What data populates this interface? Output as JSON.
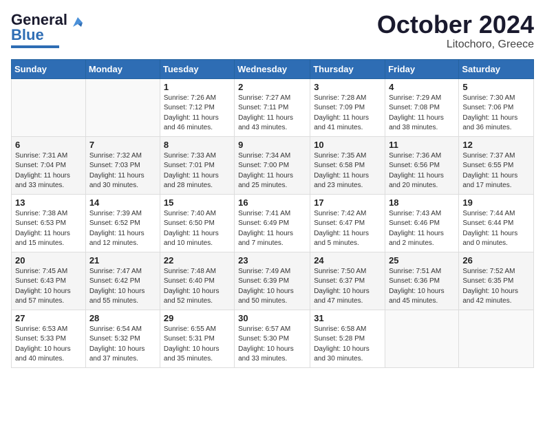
{
  "header": {
    "logo_line1": "General",
    "logo_line2": "Blue",
    "month": "October 2024",
    "location": "Litochoro, Greece"
  },
  "weekdays": [
    "Sunday",
    "Monday",
    "Tuesday",
    "Wednesday",
    "Thursday",
    "Friday",
    "Saturday"
  ],
  "weeks": [
    [
      {
        "day": "",
        "info": ""
      },
      {
        "day": "",
        "info": ""
      },
      {
        "day": "1",
        "info": "Sunrise: 7:26 AM\nSunset: 7:12 PM\nDaylight: 11 hours and 46 minutes."
      },
      {
        "day": "2",
        "info": "Sunrise: 7:27 AM\nSunset: 7:11 PM\nDaylight: 11 hours and 43 minutes."
      },
      {
        "day": "3",
        "info": "Sunrise: 7:28 AM\nSunset: 7:09 PM\nDaylight: 11 hours and 41 minutes."
      },
      {
        "day": "4",
        "info": "Sunrise: 7:29 AM\nSunset: 7:08 PM\nDaylight: 11 hours and 38 minutes."
      },
      {
        "day": "5",
        "info": "Sunrise: 7:30 AM\nSunset: 7:06 PM\nDaylight: 11 hours and 36 minutes."
      }
    ],
    [
      {
        "day": "6",
        "info": "Sunrise: 7:31 AM\nSunset: 7:04 PM\nDaylight: 11 hours and 33 minutes."
      },
      {
        "day": "7",
        "info": "Sunrise: 7:32 AM\nSunset: 7:03 PM\nDaylight: 11 hours and 30 minutes."
      },
      {
        "day": "8",
        "info": "Sunrise: 7:33 AM\nSunset: 7:01 PM\nDaylight: 11 hours and 28 minutes."
      },
      {
        "day": "9",
        "info": "Sunrise: 7:34 AM\nSunset: 7:00 PM\nDaylight: 11 hours and 25 minutes."
      },
      {
        "day": "10",
        "info": "Sunrise: 7:35 AM\nSunset: 6:58 PM\nDaylight: 11 hours and 23 minutes."
      },
      {
        "day": "11",
        "info": "Sunrise: 7:36 AM\nSunset: 6:56 PM\nDaylight: 11 hours and 20 minutes."
      },
      {
        "day": "12",
        "info": "Sunrise: 7:37 AM\nSunset: 6:55 PM\nDaylight: 11 hours and 17 minutes."
      }
    ],
    [
      {
        "day": "13",
        "info": "Sunrise: 7:38 AM\nSunset: 6:53 PM\nDaylight: 11 hours and 15 minutes."
      },
      {
        "day": "14",
        "info": "Sunrise: 7:39 AM\nSunset: 6:52 PM\nDaylight: 11 hours and 12 minutes."
      },
      {
        "day": "15",
        "info": "Sunrise: 7:40 AM\nSunset: 6:50 PM\nDaylight: 11 hours and 10 minutes."
      },
      {
        "day": "16",
        "info": "Sunrise: 7:41 AM\nSunset: 6:49 PM\nDaylight: 11 hours and 7 minutes."
      },
      {
        "day": "17",
        "info": "Sunrise: 7:42 AM\nSunset: 6:47 PM\nDaylight: 11 hours and 5 minutes."
      },
      {
        "day": "18",
        "info": "Sunrise: 7:43 AM\nSunset: 6:46 PM\nDaylight: 11 hours and 2 minutes."
      },
      {
        "day": "19",
        "info": "Sunrise: 7:44 AM\nSunset: 6:44 PM\nDaylight: 11 hours and 0 minutes."
      }
    ],
    [
      {
        "day": "20",
        "info": "Sunrise: 7:45 AM\nSunset: 6:43 PM\nDaylight: 10 hours and 57 minutes."
      },
      {
        "day": "21",
        "info": "Sunrise: 7:47 AM\nSunset: 6:42 PM\nDaylight: 10 hours and 55 minutes."
      },
      {
        "day": "22",
        "info": "Sunrise: 7:48 AM\nSunset: 6:40 PM\nDaylight: 10 hours and 52 minutes."
      },
      {
        "day": "23",
        "info": "Sunrise: 7:49 AM\nSunset: 6:39 PM\nDaylight: 10 hours and 50 minutes."
      },
      {
        "day": "24",
        "info": "Sunrise: 7:50 AM\nSunset: 6:37 PM\nDaylight: 10 hours and 47 minutes."
      },
      {
        "day": "25",
        "info": "Sunrise: 7:51 AM\nSunset: 6:36 PM\nDaylight: 10 hours and 45 minutes."
      },
      {
        "day": "26",
        "info": "Sunrise: 7:52 AM\nSunset: 6:35 PM\nDaylight: 10 hours and 42 minutes."
      }
    ],
    [
      {
        "day": "27",
        "info": "Sunrise: 6:53 AM\nSunset: 5:33 PM\nDaylight: 10 hours and 40 minutes."
      },
      {
        "day": "28",
        "info": "Sunrise: 6:54 AM\nSunset: 5:32 PM\nDaylight: 10 hours and 37 minutes."
      },
      {
        "day": "29",
        "info": "Sunrise: 6:55 AM\nSunset: 5:31 PM\nDaylight: 10 hours and 35 minutes."
      },
      {
        "day": "30",
        "info": "Sunrise: 6:57 AM\nSunset: 5:30 PM\nDaylight: 10 hours and 33 minutes."
      },
      {
        "day": "31",
        "info": "Sunrise: 6:58 AM\nSunset: 5:28 PM\nDaylight: 10 hours and 30 minutes."
      },
      {
        "day": "",
        "info": ""
      },
      {
        "day": "",
        "info": ""
      }
    ]
  ]
}
